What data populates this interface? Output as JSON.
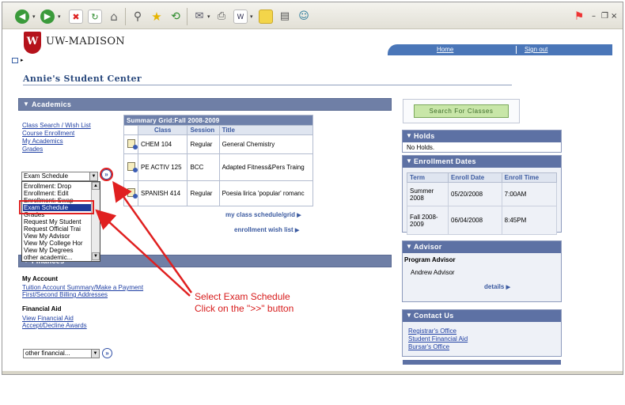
{
  "browser": {
    "toolbar_icons": [
      "back-icon",
      "forward-icon",
      "stop-icon",
      "refresh-icon",
      "home-icon",
      "search-icon",
      "favorites-icon",
      "history-icon",
      "mail-icon",
      "print-icon",
      "edit-icon",
      "discuss-icon",
      "research-icon",
      "messenger-icon"
    ],
    "window_buttons": [
      "–",
      "❐",
      "×"
    ]
  },
  "header": {
    "logo_text": "UW-MADISON",
    "crest_letter": "W",
    "nav": {
      "home": "Home",
      "signout": "Sign out"
    }
  },
  "page_title": "Annie's Student Center",
  "academics": {
    "title": "Academics",
    "links": [
      "Class Search / Wish List",
      "Course Enrollment",
      "My Academics",
      "Grades"
    ],
    "select_value": "Exam Schedule",
    "go_label": "»",
    "dropdown_options": [
      "Enrollment: Drop",
      "Enrollment: Edit",
      "Enrollment: Swap",
      "Exam Schedule",
      "Grades",
      "Request My Student",
      "Request Official Trai",
      "View My Advisor",
      "View My College Hor",
      "View My Degrees",
      "other academic..."
    ],
    "selected_index": 3,
    "grid_caption": "Summary Grid:Fall 2008-2009",
    "grid_headers": [
      "Class",
      "Session",
      "Title"
    ],
    "grid_rows": [
      {
        "class": "CHEM 104",
        "session": "Regular",
        "title": "General Chemistry"
      },
      {
        "class": "PE ACTIV 125",
        "session": "BCC",
        "title": "Adapted Fitness&Pers Traing"
      },
      {
        "class": "SPANISH 414",
        "session": "Regular",
        "title": "Poesia lirica 'popular' romanc"
      }
    ],
    "schedule_link": "my class schedule/grid",
    "wishlist_link": "enrollment wish list"
  },
  "finances": {
    "title": "Finances",
    "my_account_heading": "My Account",
    "account_links": [
      "Tuition Account Summary/Make a Payment",
      "First/Second Billing Addresses"
    ],
    "financial_aid_heading": "Financial Aid",
    "aid_links": [
      "View Financial Aid",
      "Accept/Decline Awards"
    ],
    "select_value": "other financial...",
    "go_label": "»"
  },
  "callout": {
    "line1": "Select Exam Schedule",
    "line2": "Click on the \">>\" button"
  },
  "sidebar": {
    "search_button": "Search For Classes",
    "holds": {
      "title": "Holds",
      "text": "No Holds."
    },
    "enrollment_dates": {
      "title": "Enrollment Dates",
      "headers": [
        "Term",
        "Enroll Date",
        "Enroll Time"
      ],
      "rows": [
        {
          "term": "Summer 2008",
          "date": "05/20/2008",
          "time": "7:00AM"
        },
        {
          "term": "Fall 2008-2009",
          "date": "06/04/2008",
          "time": "8:45PM"
        }
      ]
    },
    "advisor": {
      "title": "Advisor",
      "label": "Program Advisor",
      "name": "Andrew Advisor",
      "details": "details"
    },
    "contact": {
      "title": "Contact Us",
      "links": [
        "Registrar's Office",
        "Student Financial Aid",
        "Bursar's Office"
      ]
    }
  },
  "colors": {
    "section_bar": "#6f7fa6",
    "link": "#1f3fa3",
    "annotation": "#e02020",
    "nav": "#4a76b8"
  }
}
